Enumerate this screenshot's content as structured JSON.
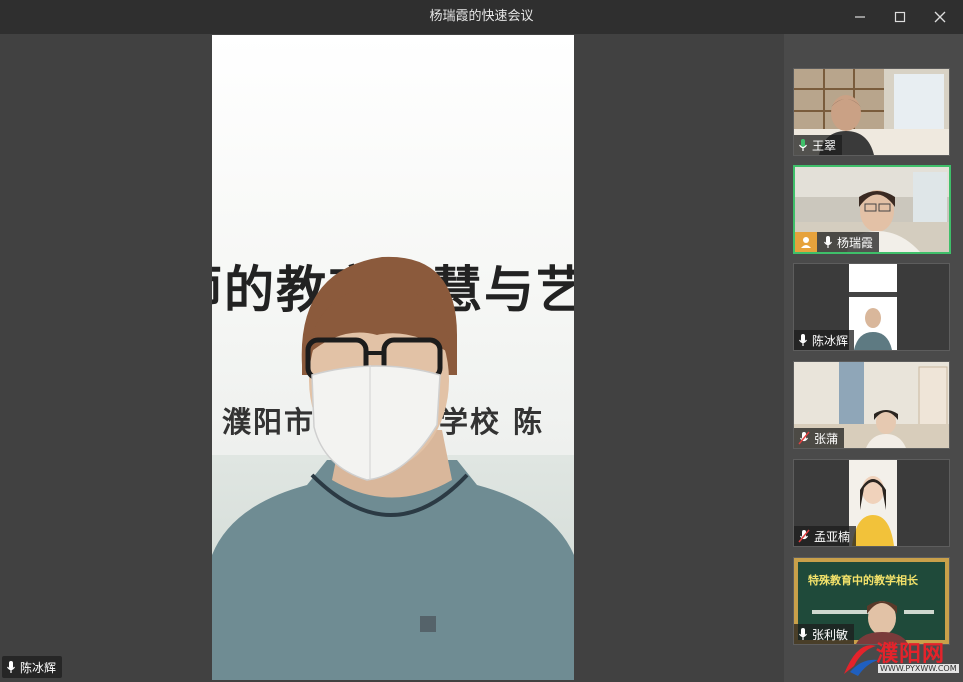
{
  "window": {
    "title": "杨瑞霞的快速会议",
    "min_icon": "minimize-icon",
    "max_icon": "maximize-icon",
    "close_icon": "close-icon"
  },
  "main_video": {
    "slide_line1": "师的教育智慧与艺",
    "slide_line2": "濮阳市特殊教育学校  陈",
    "speaker_name": "陈冰辉",
    "mic_icon": "microphone-icon"
  },
  "participants": [
    {
      "name": "王翠",
      "mic": "microphone-active-icon"
    },
    {
      "name": "杨瑞霞",
      "host": true,
      "mic": "microphone-icon",
      "active": true
    },
    {
      "name": "陈冰辉",
      "mic": "microphone-icon"
    },
    {
      "name": "张蒲",
      "mic": "microphone-muted-icon"
    },
    {
      "name": "孟亚楠",
      "mic": "microphone-muted-icon"
    },
    {
      "name": "张利敏",
      "mic": "microphone-icon",
      "slide_text": "特殊教育中的教学相长"
    }
  ],
  "watermark": {
    "brand": "濮阳网",
    "url": "WWW.PYXWW.COM"
  },
  "colors": {
    "active_border": "#3fbf6a",
    "host_badge": "#e6a23c",
    "mic_active": "#3fbf6a",
    "mic_muted": "#e04040",
    "watermark_red": "#e4232b"
  }
}
